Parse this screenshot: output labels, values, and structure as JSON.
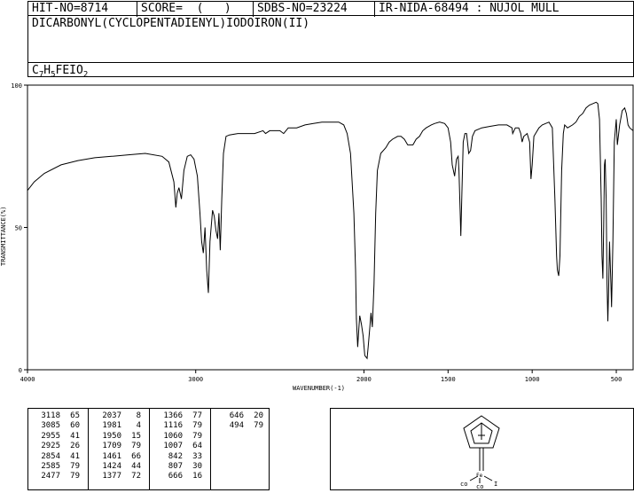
{
  "header": {
    "hit_no": "HIT-NO=8714",
    "score": "SCORE=  (   )",
    "sdbs_no": "SDBS-NO=23224",
    "ir_id": "IR-NIDA-68494 : NUJOL MULL"
  },
  "compound_name": "DICARBONYL(CYCLOPENTADIENYL)IODOIRON(II)",
  "formula": {
    "c": "C",
    "c_n": "7",
    "h": "H",
    "h_n": "5",
    "rest": "FEIO",
    "o_n": "2"
  },
  "chart_data": {
    "type": "line",
    "xlabel": "WAVENUMBER(-1)",
    "ylabel": "TRANSMITTANCE(%)",
    "xlim": [
      4000,
      400
    ],
    "ylim": [
      0,
      100
    ],
    "x_ticks": [
      4000,
      3000,
      2000,
      1500,
      1000,
      500
    ],
    "y_ticks": [
      0,
      50,
      100
    ],
    "series": [
      {
        "points": [
          [
            4000,
            63
          ],
          [
            3960,
            66
          ],
          [
            3900,
            69
          ],
          [
            3800,
            72
          ],
          [
            3700,
            73.5
          ],
          [
            3600,
            74.5
          ],
          [
            3500,
            75
          ],
          [
            3400,
            75.5
          ],
          [
            3300,
            76
          ],
          [
            3200,
            75
          ],
          [
            3160,
            73
          ],
          [
            3130,
            66
          ],
          [
            3118,
            57
          ],
          [
            3110,
            62
          ],
          [
            3100,
            64
          ],
          [
            3085,
            60
          ],
          [
            3070,
            70
          ],
          [
            3050,
            75
          ],
          [
            3030,
            75.5
          ],
          [
            3010,
            74
          ],
          [
            2990,
            68
          ],
          [
            2975,
            55
          ],
          [
            2965,
            45
          ],
          [
            2955,
            41
          ],
          [
            2945,
            50
          ],
          [
            2935,
            35
          ],
          [
            2925,
            27
          ],
          [
            2915,
            45
          ],
          [
            2900,
            56
          ],
          [
            2890,
            54
          ],
          [
            2880,
            49
          ],
          [
            2870,
            46
          ],
          [
            2862,
            55
          ],
          [
            2854,
            42
          ],
          [
            2845,
            60
          ],
          [
            2835,
            76
          ],
          [
            2820,
            82
          ],
          [
            2800,
            82.5
          ],
          [
            2750,
            83
          ],
          [
            2700,
            83
          ],
          [
            2650,
            83
          ],
          [
            2600,
            84
          ],
          [
            2585,
            83
          ],
          [
            2560,
            84
          ],
          [
            2500,
            84
          ],
          [
            2477,
            83
          ],
          [
            2450,
            85
          ],
          [
            2400,
            85
          ],
          [
            2350,
            86
          ],
          [
            2300,
            86.5
          ],
          [
            2250,
            87
          ],
          [
            2200,
            87
          ],
          [
            2150,
            87
          ],
          [
            2120,
            86
          ],
          [
            2100,
            83
          ],
          [
            2080,
            76
          ],
          [
            2060,
            55
          ],
          [
            2050,
            35
          ],
          [
            2045,
            18
          ],
          [
            2037,
            8
          ],
          [
            2030,
            15
          ],
          [
            2025,
            19
          ],
          [
            2015,
            16
          ],
          [
            2005,
            12
          ],
          [
            1995,
            5
          ],
          [
            1981,
            4
          ],
          [
            1975,
            8
          ],
          [
            1965,
            15
          ],
          [
            1958,
            20
          ],
          [
            1950,
            15
          ],
          [
            1940,
            30
          ],
          [
            1930,
            55
          ],
          [
            1920,
            70
          ],
          [
            1900,
            76
          ],
          [
            1870,
            78
          ],
          [
            1850,
            80
          ],
          [
            1830,
            81
          ],
          [
            1800,
            82
          ],
          [
            1780,
            82
          ],
          [
            1760,
            81
          ],
          [
            1740,
            79
          ],
          [
            1720,
            79
          ],
          [
            1709,
            79
          ],
          [
            1690,
            81
          ],
          [
            1670,
            82
          ],
          [
            1650,
            84
          ],
          [
            1630,
            85
          ],
          [
            1600,
            86
          ],
          [
            1580,
            86.5
          ],
          [
            1550,
            87
          ],
          [
            1520,
            86.5
          ],
          [
            1500,
            85
          ],
          [
            1485,
            80
          ],
          [
            1475,
            72
          ],
          [
            1461,
            68
          ],
          [
            1450,
            74
          ],
          [
            1440,
            75
          ],
          [
            1435,
            70
          ],
          [
            1428,
            55
          ],
          [
            1424,
            47
          ],
          [
            1418,
            62
          ],
          [
            1410,
            80
          ],
          [
            1400,
            83
          ],
          [
            1390,
            83
          ],
          [
            1377,
            76
          ],
          [
            1366,
            77
          ],
          [
            1355,
            82
          ],
          [
            1340,
            84
          ],
          [
            1300,
            85
          ],
          [
            1250,
            85.5
          ],
          [
            1200,
            86
          ],
          [
            1150,
            86
          ],
          [
            1120,
            85
          ],
          [
            1116,
            83
          ],
          [
            1100,
            85
          ],
          [
            1080,
            85
          ],
          [
            1068,
            83
          ],
          [
            1060,
            80
          ],
          [
            1050,
            82
          ],
          [
            1030,
            83
          ],
          [
            1015,
            80
          ],
          [
            1007,
            67
          ],
          [
            1000,
            72
          ],
          [
            990,
            82
          ],
          [
            960,
            85
          ],
          [
            940,
            86
          ],
          [
            900,
            87
          ],
          [
            880,
            85
          ],
          [
            865,
            60
          ],
          [
            855,
            40
          ],
          [
            850,
            35
          ],
          [
            842,
            33
          ],
          [
            835,
            40
          ],
          [
            825,
            70
          ],
          [
            815,
            83
          ],
          [
            807,
            86
          ],
          [
            790,
            85
          ],
          [
            760,
            86
          ],
          [
            740,
            87
          ],
          [
            720,
            89
          ],
          [
            700,
            90
          ],
          [
            680,
            92
          ],
          [
            660,
            93
          ],
          [
            640,
            93.5
          ],
          [
            620,
            94
          ],
          [
            610,
            93.5
          ],
          [
            600,
            88
          ],
          [
            590,
            60
          ],
          [
            585,
            40
          ],
          [
            580,
            32
          ],
          [
            575,
            50
          ],
          [
            570,
            72
          ],
          [
            566,
            74
          ],
          [
            560,
            60
          ],
          [
            555,
            30
          ],
          [
            550,
            17
          ],
          [
            545,
            30
          ],
          [
            540,
            45
          ],
          [
            532,
            30
          ],
          [
            528,
            22
          ],
          [
            520,
            45
          ],
          [
            512,
            80
          ],
          [
            500,
            88
          ],
          [
            494,
            79
          ],
          [
            480,
            86
          ],
          [
            465,
            91
          ],
          [
            450,
            92
          ],
          [
            440,
            90
          ],
          [
            430,
            86
          ],
          [
            420,
            85
          ],
          [
            400,
            84
          ]
        ]
      }
    ]
  },
  "peaks": [
    [
      "3118",
      "65"
    ],
    [
      "3085",
      "60"
    ],
    [
      "2955",
      "41"
    ],
    [
      "2925",
      "26"
    ],
    [
      "2854",
      "41"
    ],
    [
      "2585",
      "79"
    ],
    [
      "2477",
      "79"
    ],
    [
      "2037",
      "8"
    ],
    [
      "1981",
      "4"
    ],
    [
      "1950",
      "15"
    ],
    [
      "1709",
      "79"
    ],
    [
      "1461",
      "66"
    ],
    [
      "1424",
      "44"
    ],
    [
      "1377",
      "72"
    ],
    [
      "1366",
      "77"
    ],
    [
      "1116",
      "79"
    ],
    [
      "1060",
      "79"
    ],
    [
      "1007",
      "64"
    ],
    [
      "842",
      "33"
    ],
    [
      "807",
      "30"
    ],
    [
      "666",
      "16"
    ],
    [
      "646",
      "20"
    ],
    [
      "494",
      "79"
    ]
  ],
  "structure": {
    "fe": "Fe",
    "co1": "co",
    "co2": "co",
    "i": "I"
  }
}
